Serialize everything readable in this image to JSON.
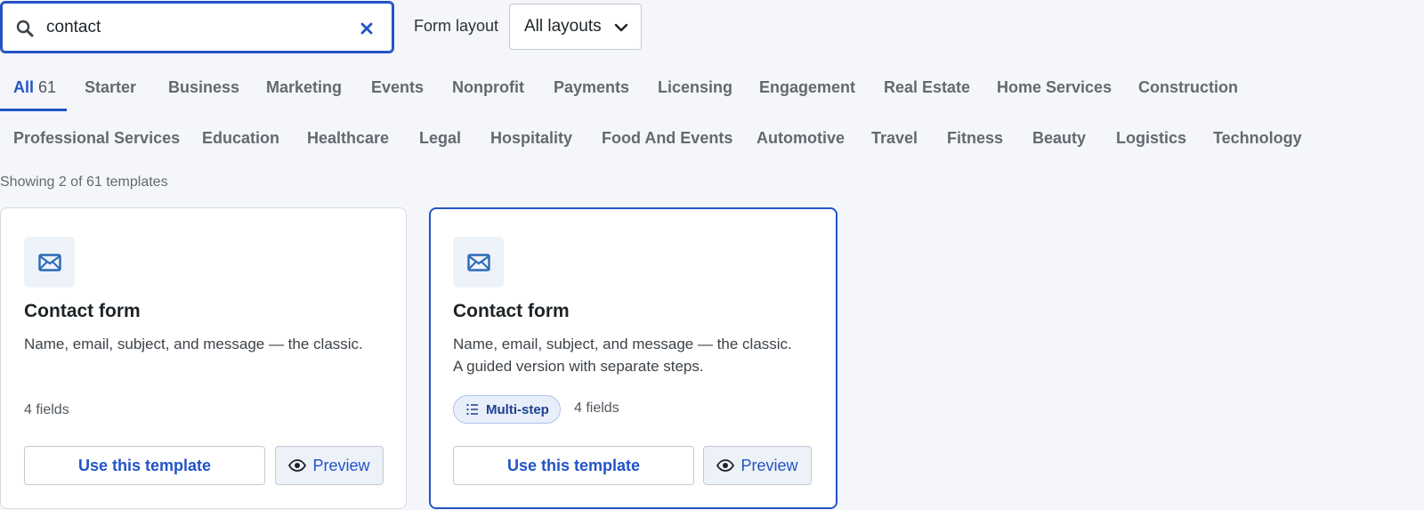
{
  "search": {
    "value": "contact",
    "placeholder": "Search templates"
  },
  "layout_filter": {
    "label": "Form layout",
    "value": "All layouts"
  },
  "tabs_row1": [
    {
      "label": "All",
      "count": "61",
      "active": true
    },
    {
      "label": "Starter"
    },
    {
      "label": "Business"
    },
    {
      "label": "Marketing"
    },
    {
      "label": "Events"
    },
    {
      "label": "Nonprofit"
    },
    {
      "label": "Payments"
    },
    {
      "label": "Licensing"
    },
    {
      "label": "Engagement"
    },
    {
      "label": "Real Estate"
    },
    {
      "label": "Home Services"
    },
    {
      "label": "Construction"
    }
  ],
  "tabs_row2": [
    {
      "label": "Professional Services"
    },
    {
      "label": "Education"
    },
    {
      "label": "Healthcare"
    },
    {
      "label": "Legal"
    },
    {
      "label": "Hospitality"
    },
    {
      "label": "Food And Events"
    },
    {
      "label": "Automotive"
    },
    {
      "label": "Travel"
    },
    {
      "label": "Fitness"
    },
    {
      "label": "Beauty"
    },
    {
      "label": "Logistics"
    },
    {
      "label": "Technology"
    }
  ],
  "results_count": "Showing 2 of 61 templates",
  "cards": [
    {
      "icon": "envelope-icon",
      "title": "Contact form",
      "description_line1": "Name, email, subject, and message — the classic.",
      "fields": "4 fields",
      "use_label": "Use this template",
      "preview_label": "Preview"
    },
    {
      "icon": "envelope-icon",
      "title": "Contact form",
      "description_line1": "Name, email, subject, and message — the classic.",
      "description_line2": "A guided version with separate steps.",
      "badge": "Multi-step",
      "fields": "4 fields",
      "use_label": "Use this template",
      "preview_label": "Preview"
    }
  ],
  "colors": {
    "accent": "#2254c5",
    "background": "#f5f6fa",
    "icon": "#2a6ab8"
  }
}
